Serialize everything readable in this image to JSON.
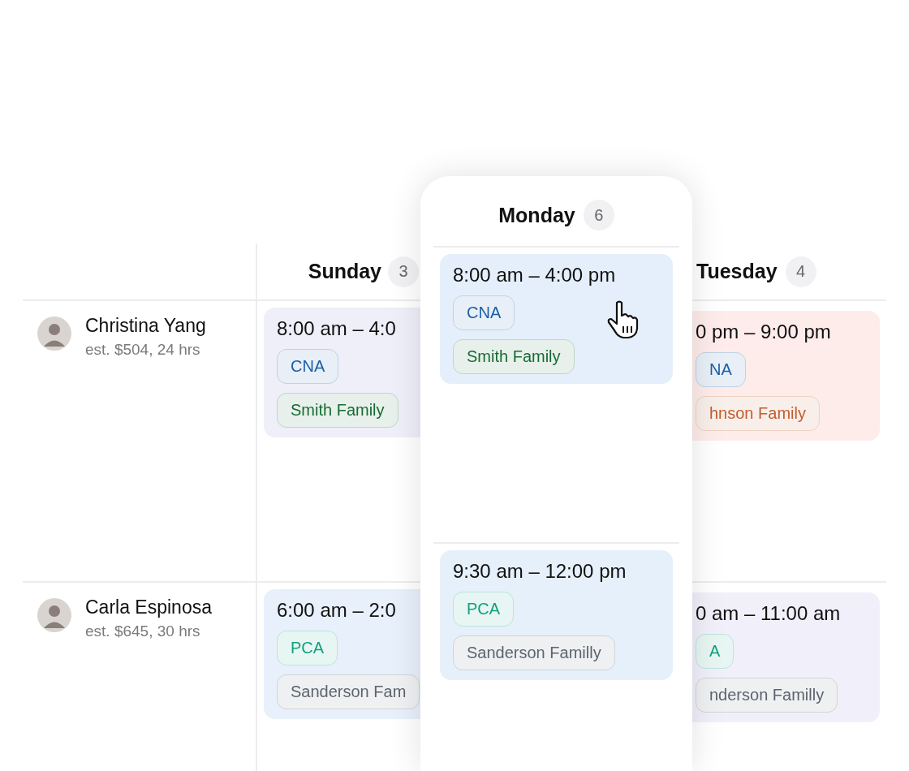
{
  "staff": [
    {
      "name": "Christina Yang",
      "estimate": "est. $504, 24 hrs"
    },
    {
      "name": "Carla Espinosa",
      "estimate": "est. $645, 30 hrs"
    }
  ],
  "days": [
    {
      "name": "Sunday",
      "count": "3",
      "shifts": [
        {
          "time": "8:00 am – 4:0",
          "color": "#efeff9",
          "chips": [
            {
              "label": "CNA",
              "color": "#1b5fa8"
            },
            {
              "label": "Smith Family",
              "color": "#176b34"
            }
          ]
        },
        {
          "time": "6:00 am – 2:0",
          "color": "#e8f0fb",
          "chips": [
            {
              "label": "PCA",
              "color": "#13a07f"
            },
            {
              "label": "Sanderson Fam",
              "color": "#5c6470"
            }
          ]
        }
      ]
    },
    {
      "name": "Monday",
      "count": "6",
      "shifts": [
        {
          "time": "8:00 am – 4:00 pm",
          "color": "#e5effb",
          "cursor": true,
          "chips": [
            {
              "label": "CNA",
              "color": "#1b5fa8"
            },
            {
              "label": "Smith Family",
              "color": "#176b34"
            }
          ]
        },
        {
          "time": "9:30 am – 12:00 pm",
          "color": "#e6f0fb",
          "chips": [
            {
              "label": "PCA",
              "color": "#13a07f"
            },
            {
              "label": "Sanderson Familly",
              "color": "#5c6470"
            }
          ]
        }
      ]
    },
    {
      "name": "Tuesday",
      "count": "4",
      "shifts": [
        {
          "time": "0 pm – 9:00 pm",
          "color": "#fdecea",
          "chips": [
            {
              "label": "NA",
              "color": "#1b5fa8"
            },
            {
              "label": "hnson Family",
              "color": "#c35d2e"
            }
          ]
        },
        {
          "time": "0 am – 11:00 am",
          "color": "#f1f0fa",
          "chips": [
            {
              "label": "A",
              "color": "#13a07f"
            },
            {
              "label": "nderson Familly",
              "color": "#5c6470"
            }
          ]
        }
      ]
    }
  ]
}
